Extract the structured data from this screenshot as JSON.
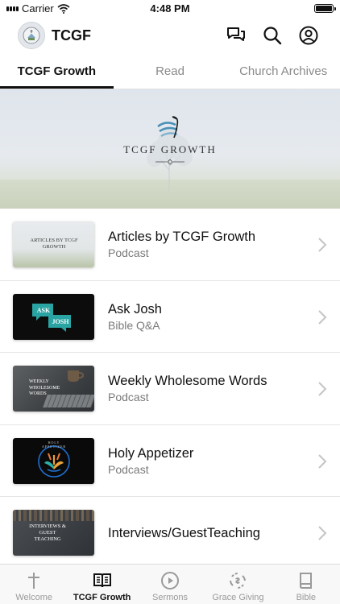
{
  "status_bar": {
    "carrier": "Carrier",
    "time": "4:48 PM"
  },
  "header": {
    "title": "TCGF"
  },
  "tabs": [
    {
      "label": "TCGF Growth",
      "active": true
    },
    {
      "label": "Read",
      "active": false
    },
    {
      "label": "Church Archives",
      "active": false
    }
  ],
  "banner": {
    "text": "TCGF GROWTH"
  },
  "list": [
    {
      "title": "Articles by TCGF Growth",
      "subtitle": "Podcast",
      "thumb_text": "ARTICLES BY TCGF GROWTH"
    },
    {
      "title": "Ask Josh",
      "subtitle": "Bible Q&A",
      "thumb_text_1": "ASK",
      "thumb_text_2": "JOSH"
    },
    {
      "title": "Weekly Wholesome Words",
      "subtitle": "Podcast",
      "thumb_text": "WEEKLY WHOLESOME WORDS"
    },
    {
      "title": "Holy Appetizer",
      "subtitle": "Podcast",
      "thumb_text": "HOLY APPETIZER"
    },
    {
      "title": "Interviews/GuestTeaching",
      "subtitle": "",
      "thumb_text": "INTERVIEWS & GUEST TEACHING"
    }
  ],
  "bottom_nav": [
    {
      "label": "Welcome",
      "icon": "cross-icon",
      "active": false
    },
    {
      "label": "TCGF Growth",
      "icon": "open-book-icon",
      "active": true
    },
    {
      "label": "Sermons",
      "icon": "play-circle-icon",
      "active": false
    },
    {
      "label": "Grace Giving",
      "icon": "giving-icon",
      "active": false
    },
    {
      "label": "Bible",
      "icon": "book-icon",
      "active": false
    }
  ],
  "colors": {
    "active": "#111111",
    "inactive": "#9a9a9a",
    "divider": "#e6e6e6"
  }
}
